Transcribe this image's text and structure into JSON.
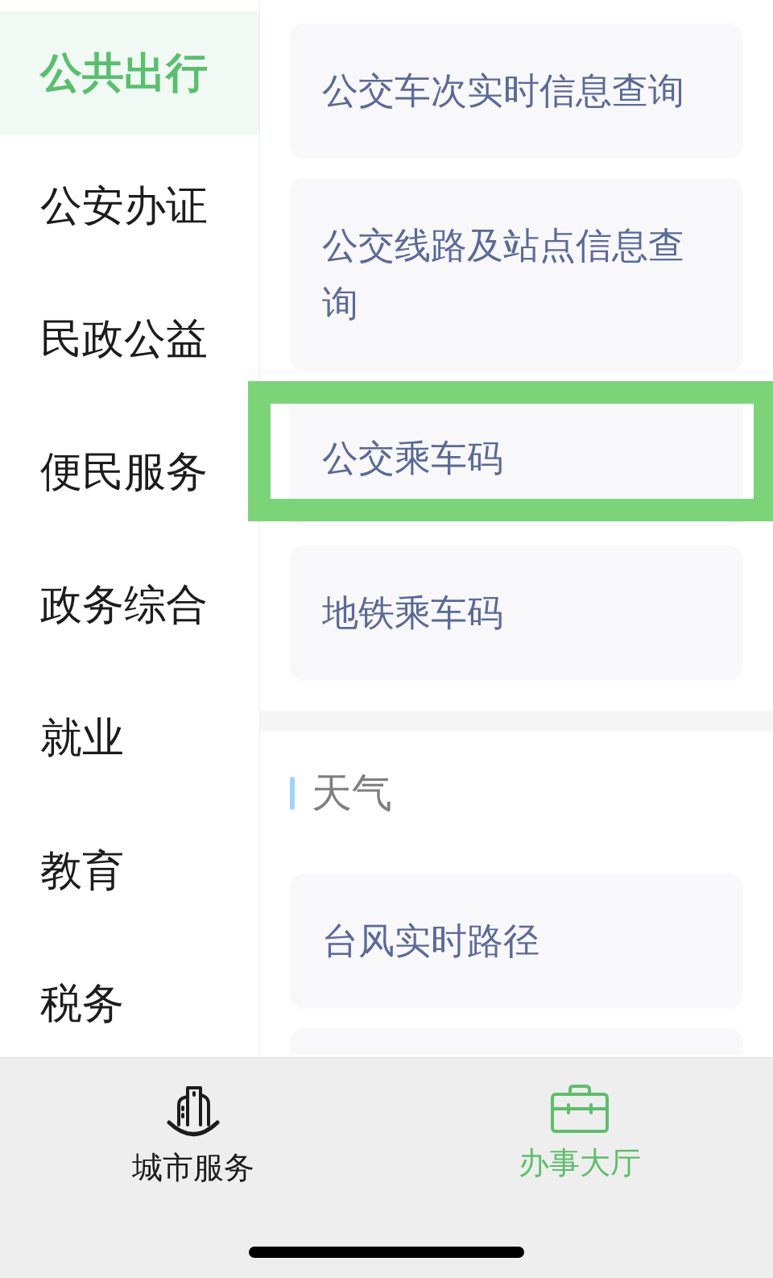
{
  "sidebar": {
    "items": [
      {
        "label": "公共出行",
        "selected": true
      },
      {
        "label": "公安办证",
        "selected": false
      },
      {
        "label": "民政公益",
        "selected": false
      },
      {
        "label": "便民服务",
        "selected": false
      },
      {
        "label": "政务综合",
        "selected": false
      },
      {
        "label": "就业",
        "selected": false
      },
      {
        "label": "教育",
        "selected": false
      },
      {
        "label": "税务",
        "selected": false
      }
    ]
  },
  "sections": [
    {
      "items": [
        {
          "kind": "service",
          "label": "公交车次实时信息查询",
          "highlighted": false
        },
        {
          "kind": "service",
          "label": "公交线路及站点信息查询",
          "highlighted": false
        },
        {
          "kind": "service",
          "label": "公交乘车码",
          "highlighted": true
        },
        {
          "kind": "service",
          "label": "地铁乘车码",
          "highlighted": false
        }
      ]
    },
    {
      "title": "天气",
      "items": [
        {
          "kind": "service",
          "label": "台风实时路径",
          "highlighted": false
        },
        {
          "kind": "cut"
        }
      ]
    }
  ],
  "tab_bar": {
    "tabs": [
      {
        "kind": "city",
        "label": "城市服务",
        "selected": false
      },
      {
        "kind": "hall",
        "label": "办事大厅",
        "selected": true
      }
    ]
  }
}
